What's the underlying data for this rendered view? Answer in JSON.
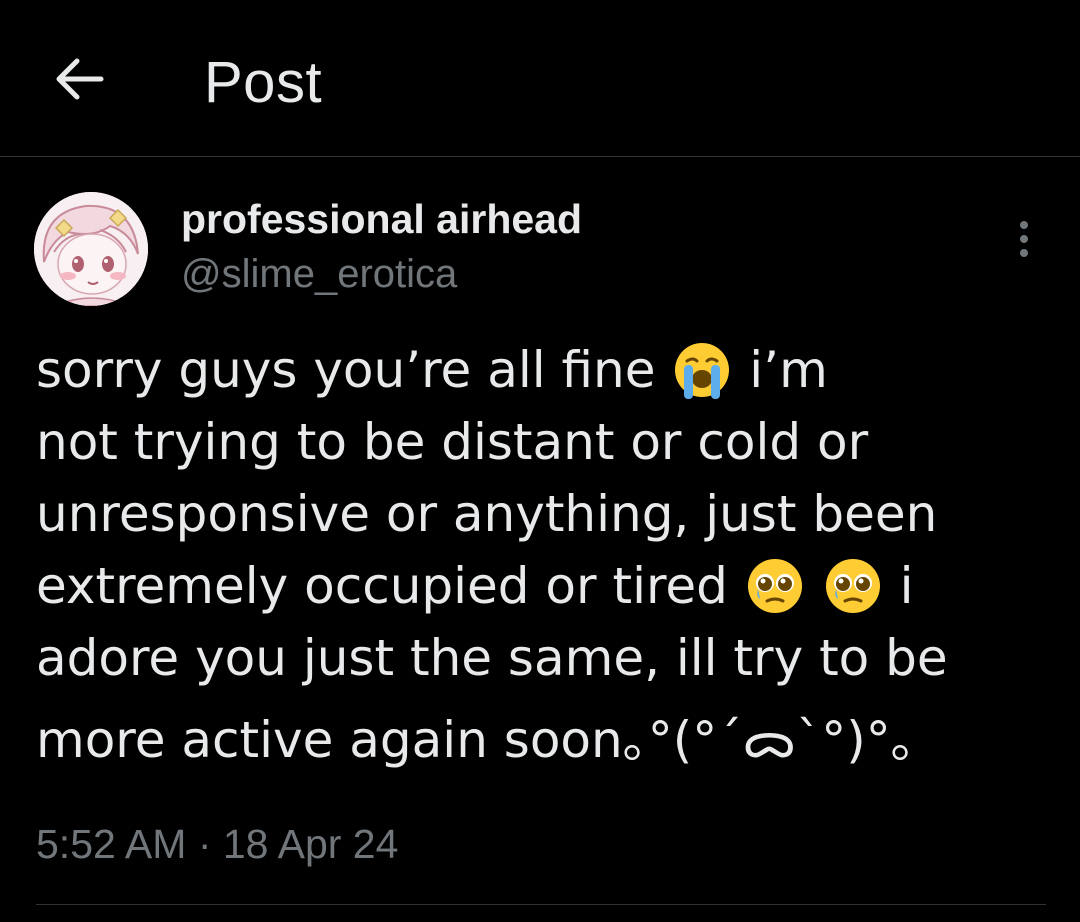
{
  "header": {
    "back_icon": "arrow-left-icon",
    "title": "Post"
  },
  "author": {
    "display_name": "professional airhead",
    "handle": "@slime_erotica",
    "avatar_icon": "anime-girl-avatar"
  },
  "more_icon": "vertical-ellipsis-icon",
  "tweet": {
    "line1_a": "sorry guys you’re all fine",
    "line1_emoji": "loudly-crying-face-emoji",
    "line1_b": "i’m",
    "line2": "not trying to be distant or cold or",
    "line3": "unresponsive or anything, just been",
    "line4_a": "extremely occupied or tired",
    "line4_emojis": [
      "pleading-face-emoji",
      "pleading-face-emoji"
    ],
    "line4_b": "i",
    "line5": "adore you just the same, ill try to be",
    "line6": "more active again soon｡°(°´ᯅ`°)°｡"
  },
  "timestamp": "5:52 AM · 18 Apr 24",
  "colors": {
    "background": "#000000",
    "primary_text": "#e7e9ea",
    "secondary_text": "#71767b",
    "divider": "#2f3336"
  }
}
